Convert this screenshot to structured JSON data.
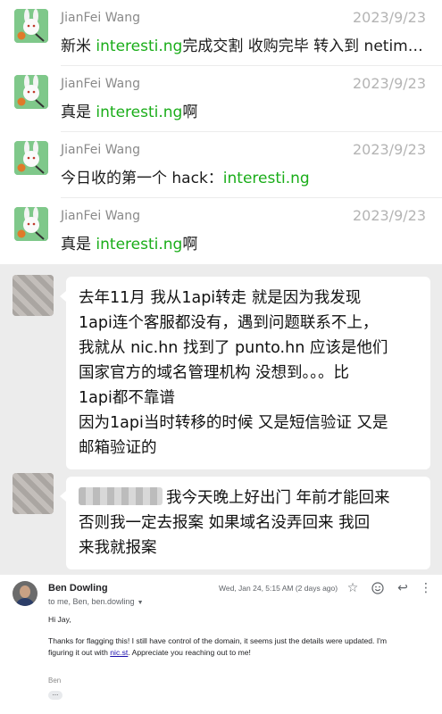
{
  "results": [
    {
      "sender": "JianFei Wang",
      "date": "2023/9/23",
      "pre": "新米 ",
      "highlight": "interesti.ng",
      "post": "完成交割 收购完毕 转入到 netim…"
    },
    {
      "sender": "JianFei Wang",
      "date": "2023/9/23",
      "pre": "真是 ",
      "highlight": "interesti.ng",
      "post": "啊"
    },
    {
      "sender": "JianFei Wang",
      "date": "2023/9/23",
      "pre": "今日收的第一个 hack：",
      "highlight": "interesti.ng",
      "post": ""
    },
    {
      "sender": "JianFei Wang",
      "date": "2023/9/23",
      "pre": "真是 ",
      "highlight": "interesti.ng",
      "post": "啊"
    }
  ],
  "chat": {
    "message1": {
      "line1": "去年11月 我从1api转走  就是因为我发现",
      "line2": "1api连个客服都没有，遇到问题联系不上，",
      "line3": "我就从 nic.hn 找到了 punto.hn 应该是他们",
      "line4": "国家官方的域名管理机构 没想到。。。比",
      "line5": "1api都不靠谱",
      "line6": "因为1api当时转移的时候 又是短信验证 又是",
      "line7": "邮箱验证的"
    },
    "message2": {
      "line1": "我今天晚上好出门 年前才能回来",
      "line2": "否则我一定去报案  如果域名没弄回来 我回",
      "line3": "来我就报案"
    }
  },
  "email": {
    "sender_name": "Ben Dowling",
    "recipients": "to me, Ben, ben.dowling",
    "timestamp": "Wed, Jan 24, 5:15 AM (2 days ago)",
    "greeting": "Hi Jay,",
    "body_line1": "Thanks for flagging this! I still have control of the domain, it seems just the details were updated. I'm",
    "body_line2_pre": "figuring it out with ",
    "body_link": "nic.st",
    "body_line2_post": ". Appreciate you reaching out to me!",
    "signature": "Ben",
    "icons": {
      "star": "star-icon",
      "emoji": "emoji-icon",
      "reply": "reply-icon",
      "more": "more-vert-icon",
      "show_trimmed": "ellipsis-icon"
    }
  }
}
